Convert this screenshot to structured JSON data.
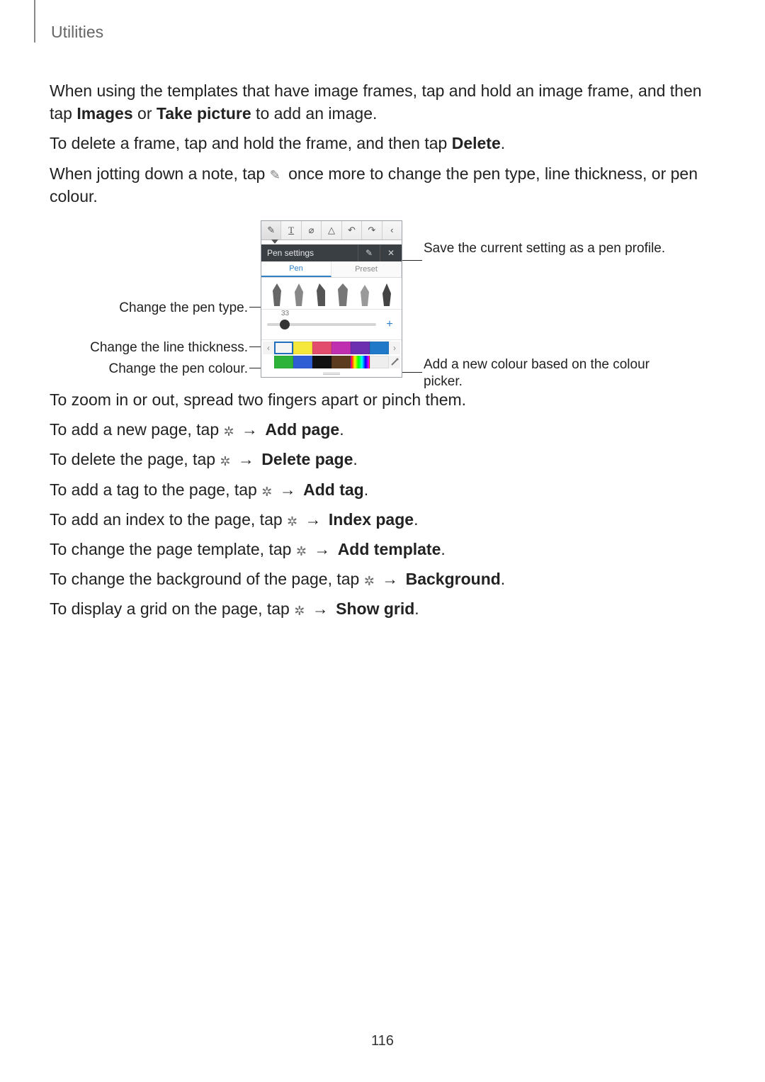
{
  "header": {
    "section": "Utilities"
  },
  "p1": {
    "pre": "When using the templates that have image frames, tap and hold an image frame, and then tap ",
    "b1": "Images",
    "mid": " or ",
    "b2": "Take picture",
    "post": " to add an image."
  },
  "p2": {
    "pre": "To delete a frame, tap and hold the frame, and then tap ",
    "b1": "Delete",
    "post": "."
  },
  "p3": {
    "pre": "When jotting down a note, tap ",
    "post": " once more to change the pen type, line thickness, or pen colour."
  },
  "figure": {
    "callouts": {
      "pen_type": "Change the pen type.",
      "thickness": "Change the line thickness.",
      "colour": "Change the pen colour.",
      "save_profile": "Save the current setting as a pen profile.",
      "add_colour": "Add a new colour based on the colour picker."
    },
    "settings_title": "Pen settings",
    "tabs": {
      "pen": "Pen",
      "preset": "Preset"
    },
    "thickness_value": "33",
    "swatches_row1": [
      "#f5f5f5",
      "#f6e83b",
      "#e24d6e",
      "#c02fb0",
      "#6b2fb0",
      "#2079c8"
    ],
    "swatches_row2": [
      "#2db23a",
      "#2f5ed4",
      "#111111",
      "#5c3b1e"
    ],
    "selected_swatch": 0
  },
  "zoom_line": "To zoom in or out, spread two fingers apart or pinch them.",
  "actions": [
    {
      "pre": "To add a new page, tap ",
      "target": "Add page",
      "post": "."
    },
    {
      "pre": "To delete the page, tap ",
      "target": "Delete page",
      "post": "."
    },
    {
      "pre": "To add a tag to the page, tap ",
      "target": "Add tag",
      "post": "."
    },
    {
      "pre": "To add an index to the page, tap ",
      "target": "Index page",
      "post": "."
    },
    {
      "pre": "To change the page template, tap ",
      "target": "Add template",
      "post": "."
    },
    {
      "pre": "To change the background of the page, tap ",
      "target": "Background",
      "post": "."
    },
    {
      "pre": "To display a grid on the page, tap ",
      "target": "Show grid",
      "post": "."
    }
  ],
  "page_number": "116",
  "glyphs": {
    "arrow": "→",
    "gear": "✲",
    "text_tool": "T",
    "eraser": "⌀",
    "shape": "△",
    "undo": "↶",
    "redo": "↷",
    "collapse": "‹",
    "wrench": "✎",
    "close": "✕",
    "left": "‹",
    "right": "›",
    "plus": "+"
  }
}
